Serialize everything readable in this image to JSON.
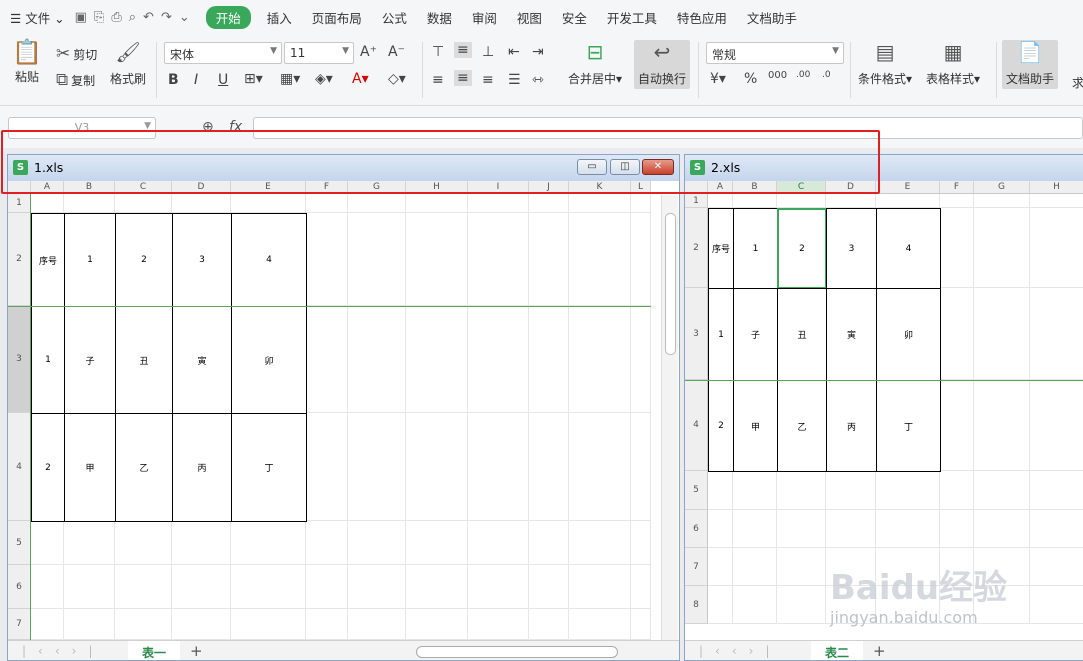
{
  "menubar": {
    "file": "文件",
    "tabs": [
      "开始",
      "插入",
      "页面布局",
      "公式",
      "数据",
      "审阅",
      "视图",
      "安全",
      "开发工具",
      "特色应用",
      "文档助手"
    ]
  },
  "ribbon": {
    "paste": "粘贴",
    "cut": "剪切",
    "copy": "复制",
    "format_painter": "格式刷",
    "font_name": "宋体",
    "font_size": "11",
    "merge": "合并居中",
    "wrap": "自动换行",
    "number_format": "常规",
    "cond_format": "条件格式",
    "table_style": "表格样式",
    "doc_assist": "文档助手",
    "more": "求"
  },
  "formula_bar": {
    "name_box": "V3",
    "fx": "fx"
  },
  "win1": {
    "title": "1.xls",
    "columns": [
      "A",
      "B",
      "C",
      "D",
      "E",
      "F",
      "G",
      "H",
      "I",
      "J",
      "K",
      "L"
    ],
    "rows": [
      "1",
      "2",
      "3",
      "4",
      "5",
      "6",
      "7"
    ],
    "cells": [
      [
        "序号",
        "1",
        "2",
        "3",
        "4"
      ],
      [
        "1",
        "子",
        "丑",
        "寅",
        "卯"
      ],
      [
        "2",
        "甲",
        "乙",
        "丙",
        "丁"
      ]
    ],
    "sheet_tab": "表一"
  },
  "win2": {
    "title": "2.xls",
    "columns": [
      "A",
      "B",
      "C",
      "D",
      "E",
      "F",
      "G",
      "H"
    ],
    "rows": [
      "1",
      "2",
      "3",
      "4",
      "5",
      "6",
      "7",
      "8"
    ],
    "cells": [
      [
        "序号",
        "1",
        "2",
        "3",
        "4"
      ],
      [
        "1",
        "子",
        "丑",
        "寅",
        "卯"
      ],
      [
        "2",
        "甲",
        "乙",
        "丙",
        "丁"
      ]
    ],
    "sheet_tab": "表二"
  },
  "watermark": {
    "main": "Baidu经验",
    "sub": "jingyan.baidu.com"
  },
  "colors": {
    "accent": "#3aa85a",
    "highlight": "#e02020"
  }
}
